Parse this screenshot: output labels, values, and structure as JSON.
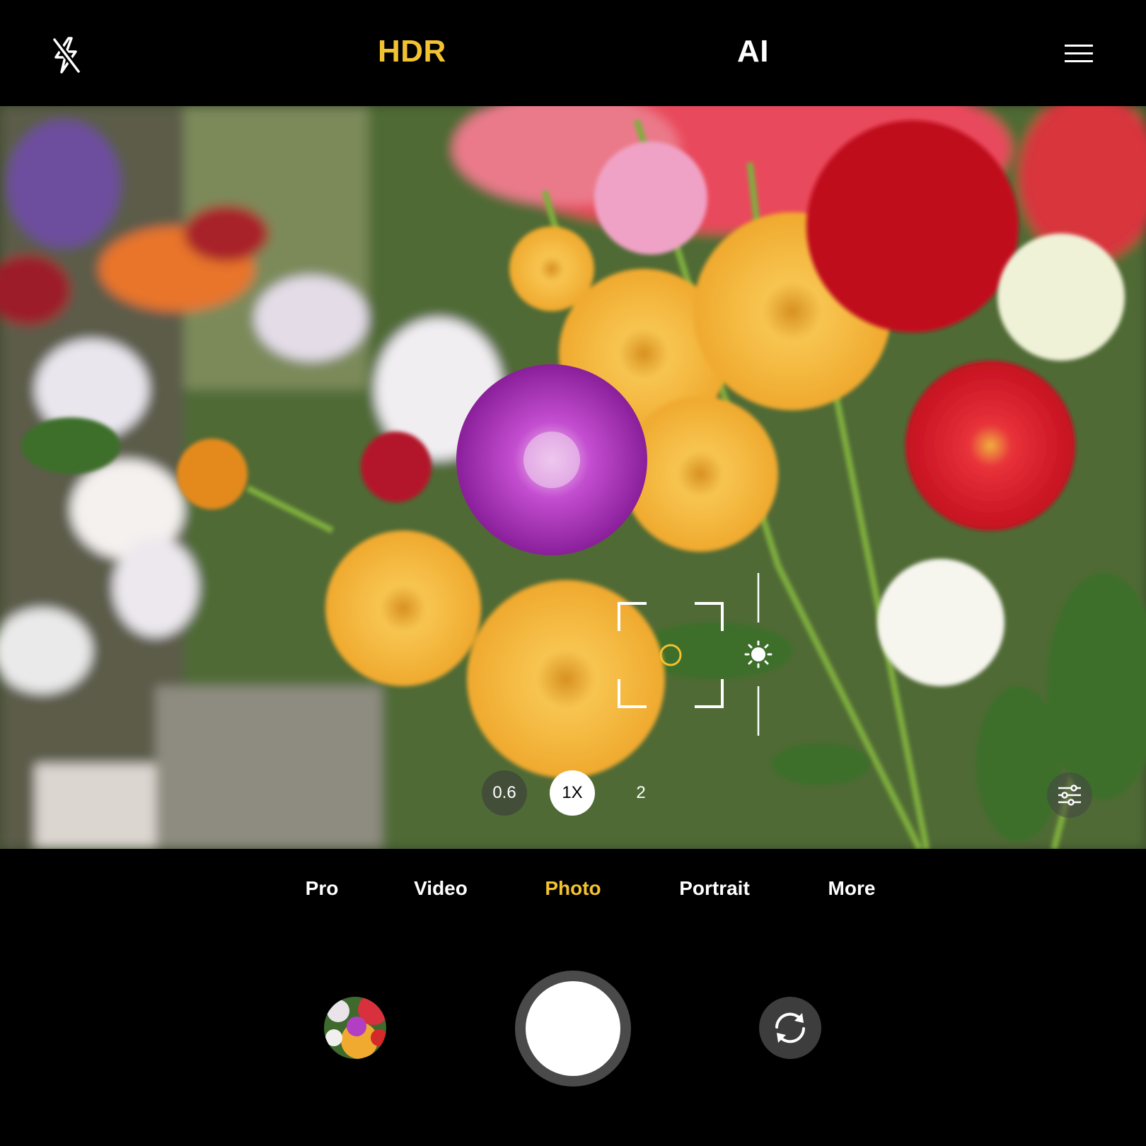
{
  "topbar": {
    "flash_icon": "flash-off-icon",
    "hdr_label": "HDR",
    "ai_label": "AI",
    "menu_icon": "hamburger-menu-icon"
  },
  "colors": {
    "accent": "#f2c230",
    "background": "#000000",
    "text": "#ffffff"
  },
  "viewfinder": {
    "focus_icon": "focus-frame-icon",
    "exposure_icon": "sun-exposure-icon",
    "settings_icon": "sliders-icon"
  },
  "zoom": {
    "options": [
      "0.6",
      "1X",
      "2"
    ],
    "selected": "1X"
  },
  "modes": {
    "items": [
      "Pro",
      "Video",
      "Photo",
      "Portrait",
      "More"
    ],
    "selected": "Photo"
  },
  "bottom": {
    "gallery_icon": "gallery-thumbnail",
    "shutter_icon": "shutter-button",
    "switch_icon": "switch-camera-icon"
  }
}
